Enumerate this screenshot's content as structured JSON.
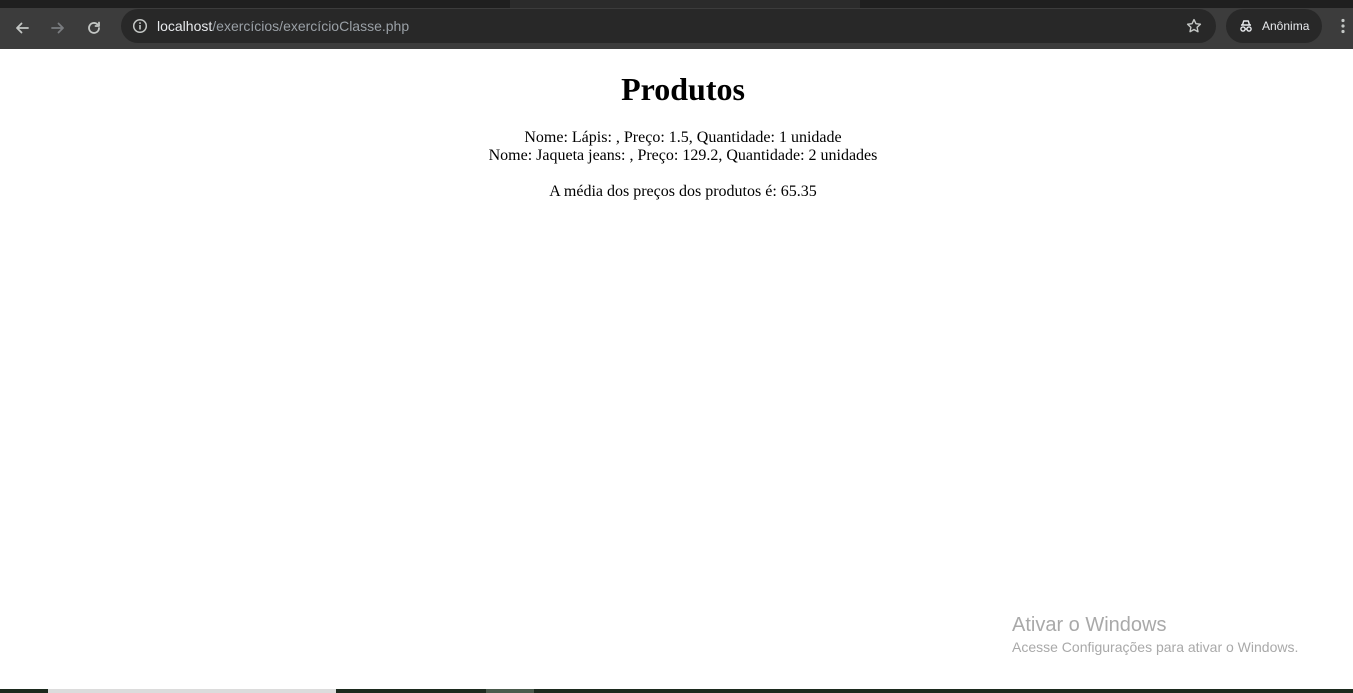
{
  "browser": {
    "url_host": "localhost",
    "url_path": "/exercícios/exercícioClasse.php",
    "profile_label": "Anônima",
    "icons": {
      "back": "back-arrow-icon",
      "forward": "forward-arrow-icon",
      "reload": "reload-icon",
      "site_info": "info-icon",
      "bookmark": "star-icon",
      "profile": "incognito-icon",
      "menu": "kebab-menu-icon"
    },
    "colors": {
      "toolbar": "#3c3c3c",
      "omnibox": "#282828",
      "url_host": "#e8eaed",
      "url_path": "#9aa0a6"
    }
  },
  "page": {
    "title": "Produtos",
    "products": [
      "Nome: Lápis: , Preço: 1.5, Quantidade: 1 unidade",
      "Nome: Jaqueta jeans: , Preço: 129.2, Quantidade: 2 unidades"
    ],
    "average": "A média dos preços dos produtos é: 65.35"
  },
  "watermark": {
    "title": "Ativar o Windows",
    "subtitle": "Acesse Configurações para ativar o Windows."
  }
}
